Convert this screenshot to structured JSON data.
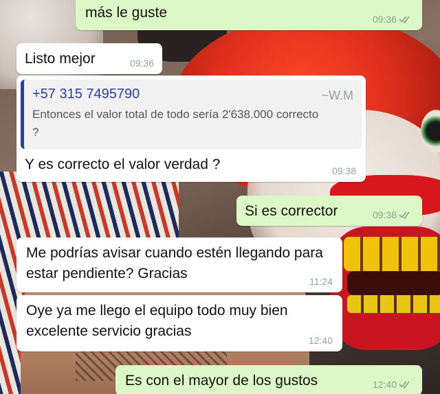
{
  "messages": [
    {
      "id": "m1",
      "direction": "outgoing",
      "text": "más le guste",
      "time": "09:36",
      "status": "read"
    },
    {
      "id": "m2",
      "direction": "incoming",
      "text": "Listo mejor",
      "time": "09:36"
    },
    {
      "id": "m3",
      "direction": "incoming",
      "quote": {
        "sender": "+57 315 7495790",
        "alias": "~W.M",
        "text": "Entonces el valor total de todo sería 2'638.000 correcto ?"
      },
      "text": "Y es correcto el valor verdad ?",
      "time": "09:38"
    },
    {
      "id": "m4",
      "direction": "outgoing",
      "text": "Si es corrector",
      "time": "09:38",
      "status": "read"
    },
    {
      "id": "m5",
      "direction": "incoming",
      "text": "Me podrías avisar cuando estén llegando para estar pendiente? Gracias",
      "time": "11:24"
    },
    {
      "id": "m6",
      "direction": "incoming",
      "text": "Oye ya me llego el equipo todo muy bien excelente servicio gracias",
      "time": "12:40"
    },
    {
      "id": "m7",
      "direction": "outgoing",
      "text": "Es con el mayor de los gustos",
      "time": "12:40",
      "status": "read"
    }
  ],
  "colors": {
    "outgoing_bubble": "#dcf8c6",
    "incoming_bubble": "#ffffff",
    "quote_accent": "#2f3da0",
    "tick_read_gray": "#8aa08a"
  },
  "icons": {
    "read_status": "double-check-icon"
  }
}
